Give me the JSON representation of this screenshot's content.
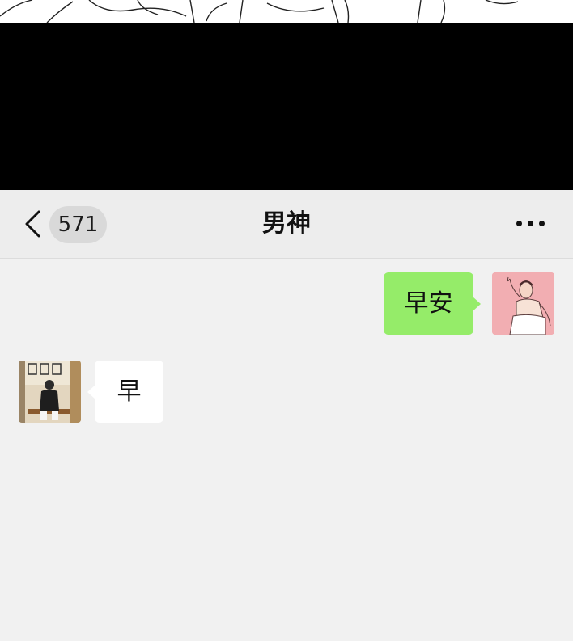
{
  "header": {
    "unread_count": "571",
    "title": "男神"
  },
  "messages": [
    {
      "direction": "outgoing",
      "text": "早安"
    },
    {
      "direction": "incoming",
      "text": "早"
    }
  ],
  "icons": {
    "back": "chevron-left-icon",
    "more": "more-dots-icon"
  },
  "colors": {
    "outgoing_bubble": "#95ec69",
    "incoming_bubble": "#ffffff",
    "chat_background": "#f1f1f1",
    "navbar_background": "#ededed"
  }
}
